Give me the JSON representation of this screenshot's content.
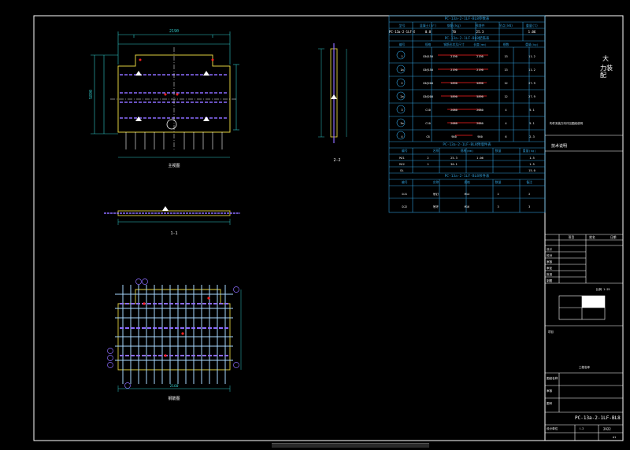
{
  "drawing_number": "PC-13a-2-1LF-BL8",
  "sheet_label": "2922",
  "company": [
    "大",
    "力",
    "装",
    "配"
  ],
  "views": {
    "plan": "主视图",
    "section_a": "1-1",
    "section_b": "2-2",
    "rebar": "钢筋图"
  },
  "dims": {
    "top_total": "2190",
    "left_total": "5890",
    "bottom_total": "2160"
  },
  "table": {
    "title_main": "PC-13a-2-1LF-BL8参数表",
    "main_header": [
      "型号",
      "混凝土(m³)",
      "钢筋(kg)",
      "预埋件",
      "吊点(kN)",
      "重量(t)"
    ],
    "main_row": [
      "PC-13a-2-1LF-BL8",
      "0.8",
      "70",
      "25.3",
      "",
      "1.06"
    ],
    "title_rebar": "PC-13a-2-1LF-BL8配筋表",
    "rebar_header": [
      "编号",
      "规格",
      "钢筋形状及尺寸",
      "长度(mm)",
      "根数",
      "重量(kg)"
    ],
    "rebar_rows": [
      [
        "1",
        "C8@150",
        "2190",
        "2190",
        "13",
        "11.2"
      ],
      [
        "1a",
        "C8@150",
        "2190",
        "2190",
        "13",
        "11.2"
      ],
      [
        "2",
        "C8@200",
        "5890",
        "5890",
        "12",
        "27.9"
      ],
      [
        "2a",
        "C8@200",
        "5890",
        "5890",
        "12",
        "27.9"
      ],
      [
        "3",
        "C10",
        "2080",
        "2080",
        "4",
        "5.1"
      ],
      [
        "3a",
        "C10",
        "2080",
        "2080",
        "4",
        "5.1"
      ],
      [
        "4",
        "C8",
        "980",
        "980",
        "6",
        "2.3"
      ]
    ],
    "title_embed": "PC-13a-2-1LF-BL8预埋件表",
    "embed_header": [
      "编号",
      "名称",
      "规格(mm)",
      "数量",
      "重量(kg)"
    ],
    "embed_rows": [
      [
        "MJ1",
        "2",
        "25.3",
        "1.06",
        "",
        "1.5"
      ],
      [
        "MJ2",
        "1",
        "30.1",
        "",
        "",
        "1.5"
      ],
      [
        "DL",
        "",
        "",
        "",
        "",
        "15.0"
      ]
    ],
    "title_lift": "PC-13a-2-1LF-BL8吊件表",
    "lift_header": [
      "编号",
      "名称",
      "规格",
      "数量",
      "备注"
    ],
    "lift_rows": [
      [
        "DJ1",
        "吊钉",
        "M14",
        "2",
        "2"
      ],
      [
        "DJ2",
        "吊环",
        "M16",
        "3",
        "3"
      ]
    ]
  },
  "note": "构件安装方向详见图纸说明",
  "title_block": {
    "note_label": "技术说明",
    "header": [
      "项目",
      "姓名",
      "日期"
    ],
    "row_labels": [
      "设计",
      "校对",
      "审核",
      "审定",
      "批准",
      "制图"
    ],
    "scale_label": "比例 1:25",
    "project_label": "项目",
    "company_label": "工程名称",
    "sheet_name": "图纸名称",
    "check_label": "审核",
    "drawing_label": "图号",
    "code": "Ⅰ-2",
    "unit_label": "设计单位",
    "date_label": "2922",
    "corner": "A1"
  },
  "colors": {
    "bg": "#000000",
    "line": "#ffffff",
    "outline": "#e0d040",
    "dim": "#30c8c8",
    "rebar": "#8c6cff",
    "table": "#2f9bd6",
    "red": "#ff2020",
    "green": "#30d030"
  }
}
